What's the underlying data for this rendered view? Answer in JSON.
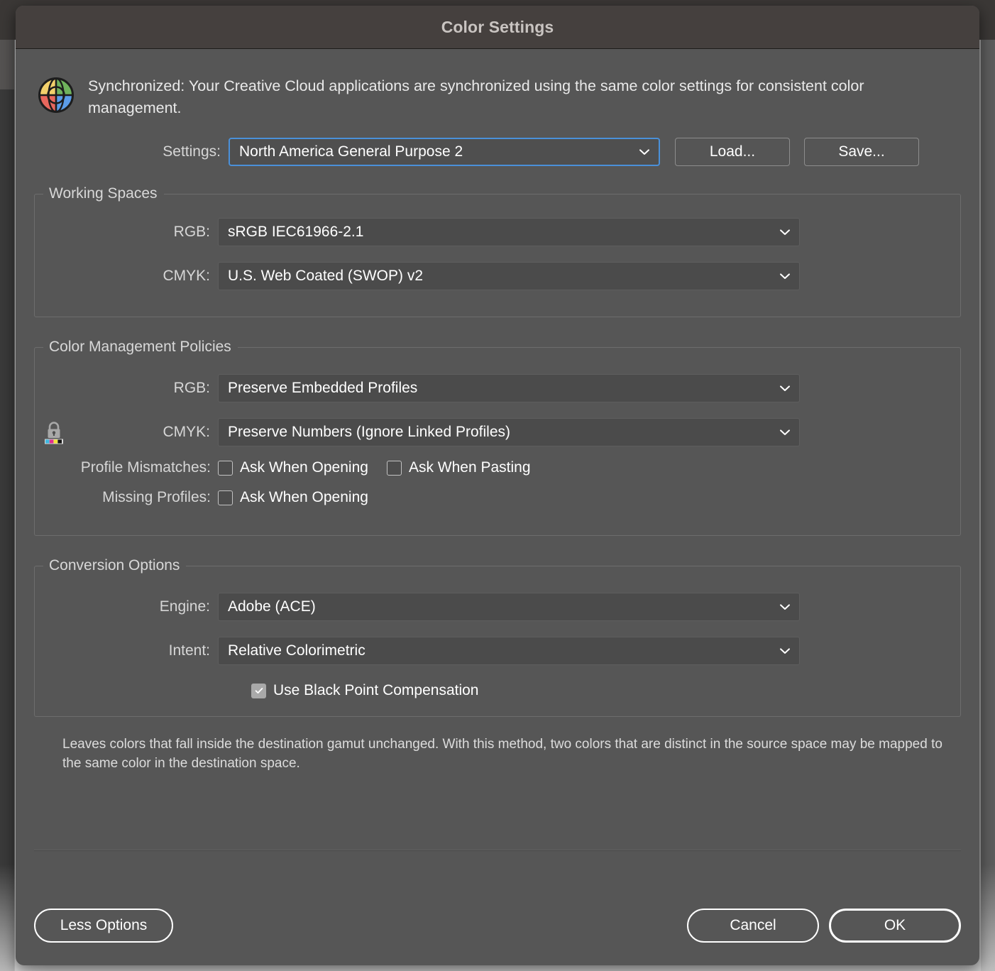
{
  "window": {
    "title": "Color Settings"
  },
  "banner": {
    "icon": "color-wheel-icon",
    "text": "Synchronized: Your Creative Cloud applications are synchronized using the same color settings for consistent color management."
  },
  "settings": {
    "label": "Settings:",
    "value": "North America General Purpose 2",
    "load_label": "Load...",
    "save_label": "Save..."
  },
  "working_spaces": {
    "legend": "Working Spaces",
    "rgb_label": "RGB:",
    "rgb_value": "sRGB IEC61966-2.1",
    "cmyk_label": "CMYK:",
    "cmyk_value": "U.S. Web Coated (SWOP) v2"
  },
  "policies": {
    "legend": "Color Management Policies",
    "rgb_label": "RGB:",
    "rgb_value": "Preserve Embedded Profiles",
    "cmyk_label": "CMYK:",
    "cmyk_value": "Preserve Numbers (Ignore Linked Profiles)",
    "lock_icon": "cmyk-lock-icon",
    "profile_mismatches_label": "Profile Mismatches:",
    "mismatch_open_label": "Ask When Opening",
    "mismatch_open_checked": false,
    "mismatch_paste_label": "Ask When Pasting",
    "mismatch_paste_checked": false,
    "missing_profiles_label": "Missing Profiles:",
    "missing_open_label": "Ask When Opening",
    "missing_open_checked": false
  },
  "conversion": {
    "legend": "Conversion Options",
    "engine_label": "Engine:",
    "engine_value": "Adobe (ACE)",
    "intent_label": "Intent:",
    "intent_value": "Relative Colorimetric",
    "bpc_label": "Use Black Point Compensation",
    "bpc_checked": true
  },
  "description": {
    "text": "Leaves colors that fall inside the destination gamut unchanged. With this method, two colors that are distinct in the source space may be mapped to the same color in the destination space."
  },
  "footer": {
    "less_options_label": "Less Options",
    "cancel_label": "Cancel",
    "ok_label": "OK"
  },
  "colors": {
    "dialog_bg": "#565656",
    "titlebar_bg": "#45403e",
    "field_bg": "#4b4b4b",
    "focus_border": "#4a90d9",
    "text": "#ffffff",
    "label_text": "#d6d6d6",
    "wheel_yellow": "#f2d06b",
    "wheel_green": "#6fb25c",
    "wheel_red": "#e8675d",
    "wheel_blue": "#5b9ce8",
    "cmyk_cyan": "#3fb8e0",
    "cmyk_magenta": "#e0308f",
    "cmyk_yellow": "#f2e23a",
    "cmyk_black": "#141414"
  }
}
